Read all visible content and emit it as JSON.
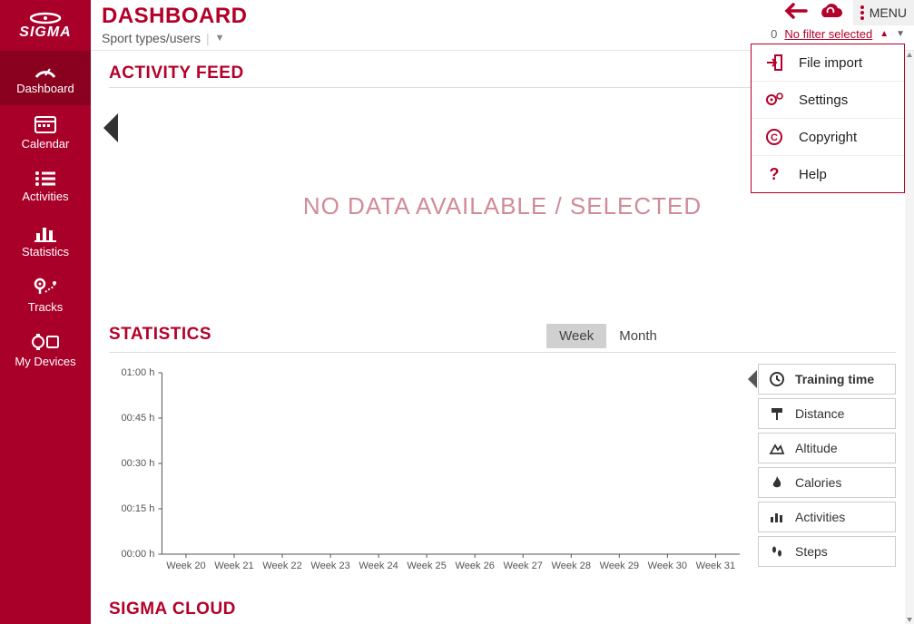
{
  "header": {
    "brand": "SIGMA",
    "title": "DASHBOARD",
    "subtitle": "Sport types/users",
    "menu_label": "MENU",
    "filter_count": "0",
    "filter_label": "No filter selected"
  },
  "sidebar": {
    "items": [
      {
        "label": "Dashboard",
        "icon": "gauge"
      },
      {
        "label": "Calendar",
        "icon": "calendar"
      },
      {
        "label": "Activities",
        "icon": "list"
      },
      {
        "label": "Statistics",
        "icon": "bar-chart"
      },
      {
        "label": "Tracks",
        "icon": "pin-route"
      },
      {
        "label": "My Devices",
        "icon": "devices"
      }
    ]
  },
  "dropdown": {
    "items": [
      {
        "label": "File import",
        "icon": "import"
      },
      {
        "label": "Settings",
        "icon": "gears"
      },
      {
        "label": "Copyright",
        "icon": "copyright"
      },
      {
        "label": "Help",
        "icon": "help"
      }
    ]
  },
  "feed": {
    "title": "ACTIVITY FEED",
    "empty": "NO DATA AVAILABLE / SELECTED"
  },
  "stats": {
    "title": "STATISTICS",
    "tabs": [
      {
        "label": "Week",
        "active": true
      },
      {
        "label": "Month",
        "active": false
      }
    ],
    "metrics": [
      {
        "label": "Training time",
        "icon": "clock",
        "active": true
      },
      {
        "label": "Distance",
        "icon": "signpost",
        "active": false
      },
      {
        "label": "Altitude",
        "icon": "mountain",
        "active": false
      },
      {
        "label": "Calories",
        "icon": "flame",
        "active": false
      },
      {
        "label": "Activities",
        "icon": "bars",
        "active": false
      },
      {
        "label": "Steps",
        "icon": "footsteps",
        "active": false
      }
    ]
  },
  "bottom": {
    "title": "SIGMA CLOUD"
  },
  "chart_data": {
    "type": "bar",
    "categories": [
      "Week 20",
      "Week 21",
      "Week 22",
      "Week 23",
      "Week 24",
      "Week 25",
      "Week 26",
      "Week 27",
      "Week 28",
      "Week 29",
      "Week 30",
      "Week 31"
    ],
    "values": [
      0,
      0,
      0,
      0,
      0,
      0,
      0,
      0,
      0,
      0,
      0,
      0
    ],
    "y_ticks": [
      "00:00 h",
      "00:15 h",
      "00:30 h",
      "00:45 h",
      "01:00 h"
    ],
    "ylim": [
      0,
      60
    ],
    "xlabel": "",
    "ylabel": "",
    "title": ""
  }
}
